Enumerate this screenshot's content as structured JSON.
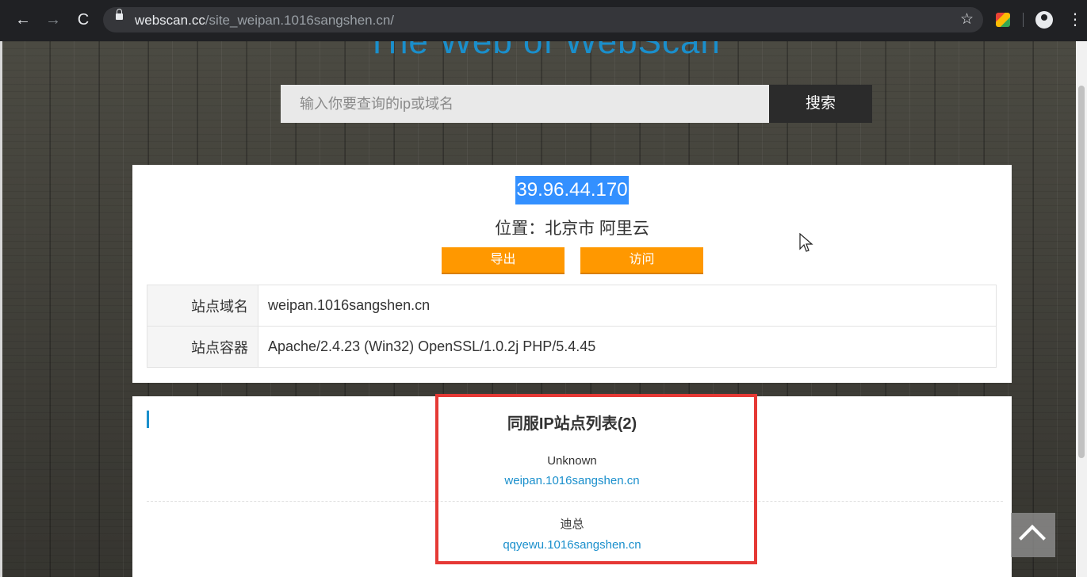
{
  "browser": {
    "url_domain": "webscan.cc",
    "url_path": "/site_weipan.1016sangshen.cn/",
    "back_icon": "←",
    "forward_icon": "→",
    "reload_icon": "C",
    "star_icon": "☆",
    "menu_icon": "⋮"
  },
  "site": {
    "title": "The Web of WebScan"
  },
  "search": {
    "placeholder": "输入你要查询的ip或域名",
    "button": "搜索"
  },
  "ip_info": {
    "ip": "39.96.44.170",
    "location": "位置：北京市 阿里云",
    "export_button": "导出",
    "visit_button": "访问",
    "rows": [
      {
        "key": "站点域名",
        "value": "weipan.1016sangshen.cn"
      },
      {
        "key": "站点容器",
        "value": "Apache/2.4.23 (Win32) OpenSSL/1.0.2j PHP/5.4.45"
      }
    ]
  },
  "same_ip": {
    "title": "同服IP站点列表(2)",
    "sites": [
      {
        "name": "Unknown",
        "domain": "weipan.1016sangshen.cn"
      },
      {
        "name": "迪总",
        "domain": "qqyewu.1016sangshen.cn"
      }
    ]
  },
  "colors": {
    "accent": "#1a8fcc",
    "orange": "#ff9800",
    "highlight": "#e53935"
  }
}
